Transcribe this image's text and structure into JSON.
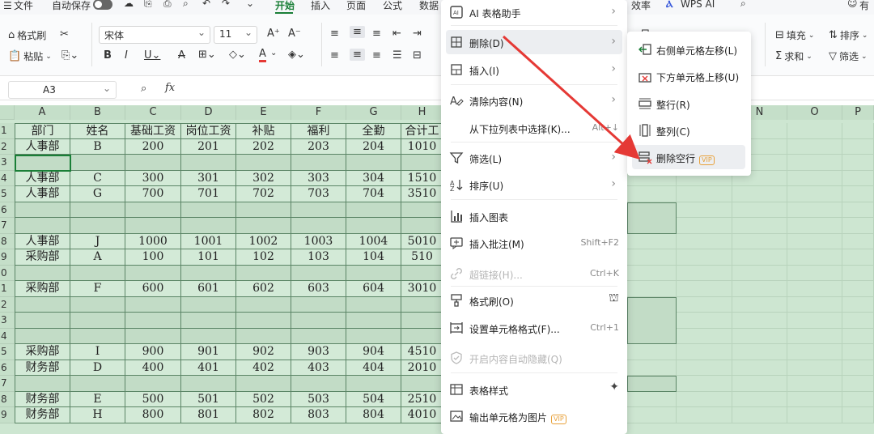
{
  "menubar": {
    "file": "文件",
    "autosave": "自动保存",
    "tabs": [
      "开始",
      "插入",
      "页面",
      "公式",
      "数据"
    ],
    "active_tab": "开始",
    "right_tab": "效率",
    "wps_ai": "WPS AI",
    "extra": "有"
  },
  "ribbon": {
    "format_painter": "格式刷",
    "paste": "粘贴",
    "font_name": "宋体",
    "font_size": "11",
    "fill": "填充",
    "sort": "排序",
    "sum": "求和",
    "filter": "筛选"
  },
  "formula_bar": {
    "name_box": "A3",
    "fx": "fx"
  },
  "sheet": {
    "columns": [
      "A",
      "B",
      "C",
      "D",
      "E",
      "F",
      "G",
      "H"
    ],
    "right_columns": [
      "N",
      "O",
      "P"
    ],
    "row_numbers": [
      "1",
      "2",
      "3",
      "4",
      "5",
      "6",
      "7",
      "8",
      "9",
      "0",
      "1",
      "2",
      "3",
      "4",
      "5",
      "6",
      "7",
      "8",
      "9"
    ],
    "rows": [
      [
        "部门",
        "姓名",
        "基础工资",
        "岗位工资",
        "补贴",
        "福利",
        "全勤",
        "合计工"
      ],
      [
        "人事部",
        "B",
        "200",
        "201",
        "202",
        "203",
        "204",
        "1010"
      ],
      [
        "",
        "",
        "",
        "",
        "",
        "",
        "",
        ""
      ],
      [
        "人事部",
        "C",
        "300",
        "301",
        "302",
        "303",
        "304",
        "1510"
      ],
      [
        "人事部",
        "G",
        "700",
        "701",
        "702",
        "703",
        "704",
        "3510"
      ],
      [
        "",
        "",
        "",
        "",
        "",
        "",
        "",
        ""
      ],
      [
        "",
        "",
        "",
        "",
        "",
        "",
        "",
        ""
      ],
      [
        "人事部",
        "J",
        "1000",
        "1001",
        "1002",
        "1003",
        "1004",
        "5010"
      ],
      [
        "采购部",
        "A",
        "100",
        "101",
        "102",
        "103",
        "104",
        "510"
      ],
      [
        "",
        "",
        "",
        "",
        "",
        "",
        "",
        ""
      ],
      [
        "采购部",
        "F",
        "600",
        "601",
        "602",
        "603",
        "604",
        "3010"
      ],
      [
        "",
        "",
        "",
        "",
        "",
        "",
        "",
        ""
      ],
      [
        "",
        "",
        "",
        "",
        "",
        "",
        "",
        ""
      ],
      [
        "",
        "",
        "",
        "",
        "",
        "",
        "",
        ""
      ],
      [
        "采购部",
        "I",
        "900",
        "901",
        "902",
        "903",
        "904",
        "4510"
      ],
      [
        "财务部",
        "D",
        "400",
        "401",
        "402",
        "403",
        "404",
        "2010"
      ],
      [
        "",
        "",
        "",
        "",
        "",
        "",
        "",
        ""
      ],
      [
        "财务部",
        "E",
        "500",
        "501",
        "502",
        "503",
        "504",
        "2510"
      ],
      [
        "财务部",
        "H",
        "800",
        "801",
        "802",
        "803",
        "804",
        "4010"
      ]
    ]
  },
  "context_menu": {
    "items": [
      {
        "label": "AI 表格助手",
        "icon": "ai-icon",
        "submenu": true
      },
      {
        "label": "删除(D)",
        "icon": "delete-icon",
        "submenu": true,
        "highlighted": true
      },
      {
        "label": "插入(I)",
        "icon": "insert-icon",
        "submenu": true
      },
      {
        "label": "清除内容(N)",
        "icon": "clear-icon",
        "submenu": true
      },
      {
        "label": "从下拉列表中选择(K)...",
        "shortcut": "Alt+↓"
      },
      {
        "label": "筛选(L)",
        "icon": "filter-icon",
        "submenu": true
      },
      {
        "label": "排序(U)",
        "icon": "sort-icon",
        "submenu": true
      },
      {
        "label": "插入图表",
        "icon": "chart-icon"
      },
      {
        "label": "插入批注(M)",
        "icon": "comment-icon",
        "shortcut": "Shift+F2"
      },
      {
        "label": "超链接(H)...",
        "icon": "link-icon",
        "shortcut": "Ctrl+K",
        "disabled": true
      },
      {
        "label": "格式刷(O)",
        "icon": "brush-icon"
      },
      {
        "label": "设置单元格格式(F)...",
        "icon": "format-cells-icon",
        "shortcut": "Ctrl+1"
      },
      {
        "label": "开启内容自动隐藏(Q)",
        "icon": "auto-hide-icon",
        "disabled": true
      },
      {
        "label": "表格样式",
        "icon": "table-style-icon"
      },
      {
        "label": "输出单元格为图片",
        "icon": "image-export-icon",
        "vip": "VIP"
      }
    ]
  },
  "submenu": {
    "items": [
      {
        "label": "右侧单元格左移(L)",
        "icon": "shift-left-icon"
      },
      {
        "label": "下方单元格上移(U)",
        "icon": "shift-up-icon"
      },
      {
        "label": "整行(R)",
        "icon": "entire-row-icon"
      },
      {
        "label": "整列(C)",
        "icon": "entire-column-icon"
      },
      {
        "label": "删除空行",
        "icon": "delete-blank-rows-icon",
        "vip": "VIP",
        "highlighted": true
      }
    ]
  },
  "colors": {
    "accent": "#1a7f37",
    "selection": "#cde6d1",
    "arrow": "#e53935",
    "vip": "#e8a13a"
  }
}
